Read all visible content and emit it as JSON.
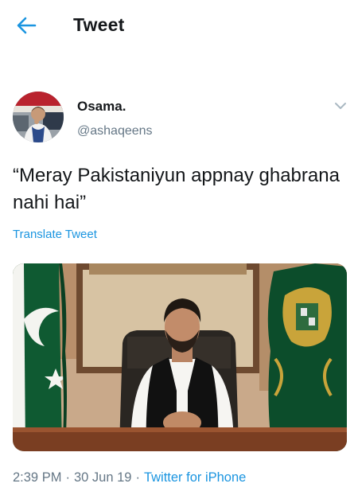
{
  "header": {
    "back_icon": "arrow-left-icon",
    "title": "Tweet"
  },
  "tweet": {
    "author": {
      "display_name": "Osama.",
      "handle": "@ashaqeens"
    },
    "menu_icon": "chevron-down-icon",
    "text": "“Meray Pakistaniyun appnay ghabrana nahi hai”",
    "translate_label": "Translate Tweet",
    "time": "2:39 PM",
    "separator": "·",
    "date": "30 Jun 19",
    "source": "Twitter for iPhone"
  },
  "colors": {
    "accent": "#1b95e0",
    "text_primary": "#14171a",
    "text_secondary": "#657786",
    "flag_green": "#0c4d2b"
  }
}
